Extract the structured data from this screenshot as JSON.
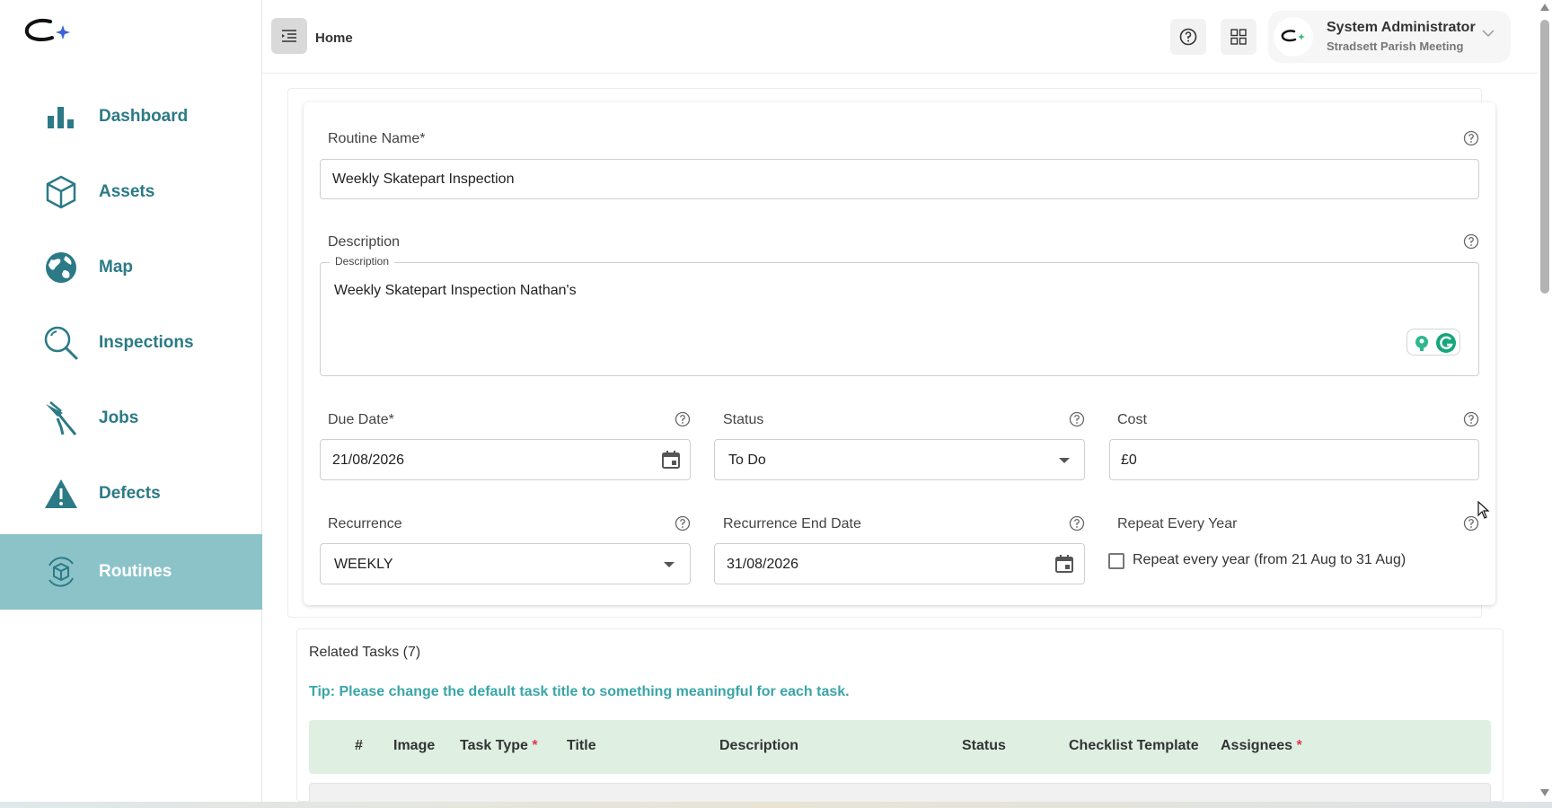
{
  "sidebar": {
    "items": [
      {
        "label": "Dashboard",
        "icon": "bar-chart-icon",
        "active": false
      },
      {
        "label": "Assets",
        "icon": "cube-icon",
        "active": false
      },
      {
        "label": "Map",
        "icon": "globe-icon",
        "active": false
      },
      {
        "label": "Inspections",
        "icon": "magnifier-icon",
        "active": false
      },
      {
        "label": "Jobs",
        "icon": "pliers-icon",
        "active": false
      },
      {
        "label": "Defects",
        "icon": "warning-icon",
        "active": false
      },
      {
        "label": "Routines",
        "icon": "refresh-cube-icon",
        "active": true
      }
    ]
  },
  "topbar": {
    "breadcrumb": "Home",
    "user_name": "System Administrator",
    "user_org": "Stradsett Parish Meeting"
  },
  "form": {
    "routine_name_label": "Routine Name*",
    "routine_name_value": "Weekly Skatepart Inspection",
    "description_label": "Description",
    "description_notch": "Description",
    "description_value": "Weekly Skatepart Inspection Nathan's",
    "due_date_label": "Due Date*",
    "due_date_value": "21/08/2026",
    "status_label": "Status",
    "status_value": "To Do",
    "cost_label": "Cost",
    "cost_value": "£0",
    "recurrence_label": "Recurrence",
    "recurrence_value": "WEEKLY",
    "recurrence_end_label": "Recurrence End Date",
    "recurrence_end_value": "31/08/2026",
    "repeat_label": "Repeat Every Year",
    "repeat_checkbox_label": "Repeat every year (from 21 Aug to 31 Aug)",
    "repeat_checked": false
  },
  "tasks": {
    "title": "Related Tasks (7)",
    "tip": "Tip: Please change the default task title to something meaningful for each task.",
    "columns": [
      {
        "label": "#",
        "required": false
      },
      {
        "label": "Image",
        "required": false
      },
      {
        "label": "Task Type",
        "required": true
      },
      {
        "label": "Title",
        "required": false
      },
      {
        "label": "Description",
        "required": false
      },
      {
        "label": "Status",
        "required": false
      },
      {
        "label": "Checklist Template",
        "required": false
      },
      {
        "label": "Assignees",
        "required": true
      }
    ]
  },
  "colors": {
    "brand_teal": "#2b7a86",
    "active_nav_bg": "#8bc3c9",
    "tip_text": "#3aa5a8",
    "table_header_bg": "#dff0e3",
    "required_star": "#e0394c"
  }
}
